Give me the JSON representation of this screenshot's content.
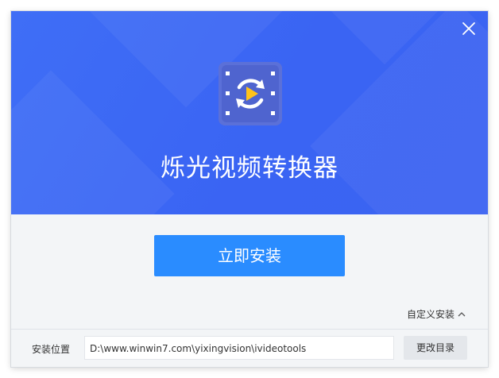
{
  "installer": {
    "app_name": "烁光视频转换器",
    "install_button_label": "立即安装",
    "custom_install_label": "自定义安装",
    "install_location_label": "安装位置",
    "install_path": "D:\\www.winwin7.com\\yixingvision\\ivideotools",
    "change_dir_label": "更改目录"
  },
  "icons": {
    "close": "close-icon",
    "app": "video-converter-logo-icon",
    "chevron": "chevron-up-icon"
  },
  "colors": {
    "banner_blue": "#3d69f4",
    "button_blue": "#2a8cff",
    "logo_bg": "#5a6fd6",
    "play_yellow": "#ffc21a"
  }
}
